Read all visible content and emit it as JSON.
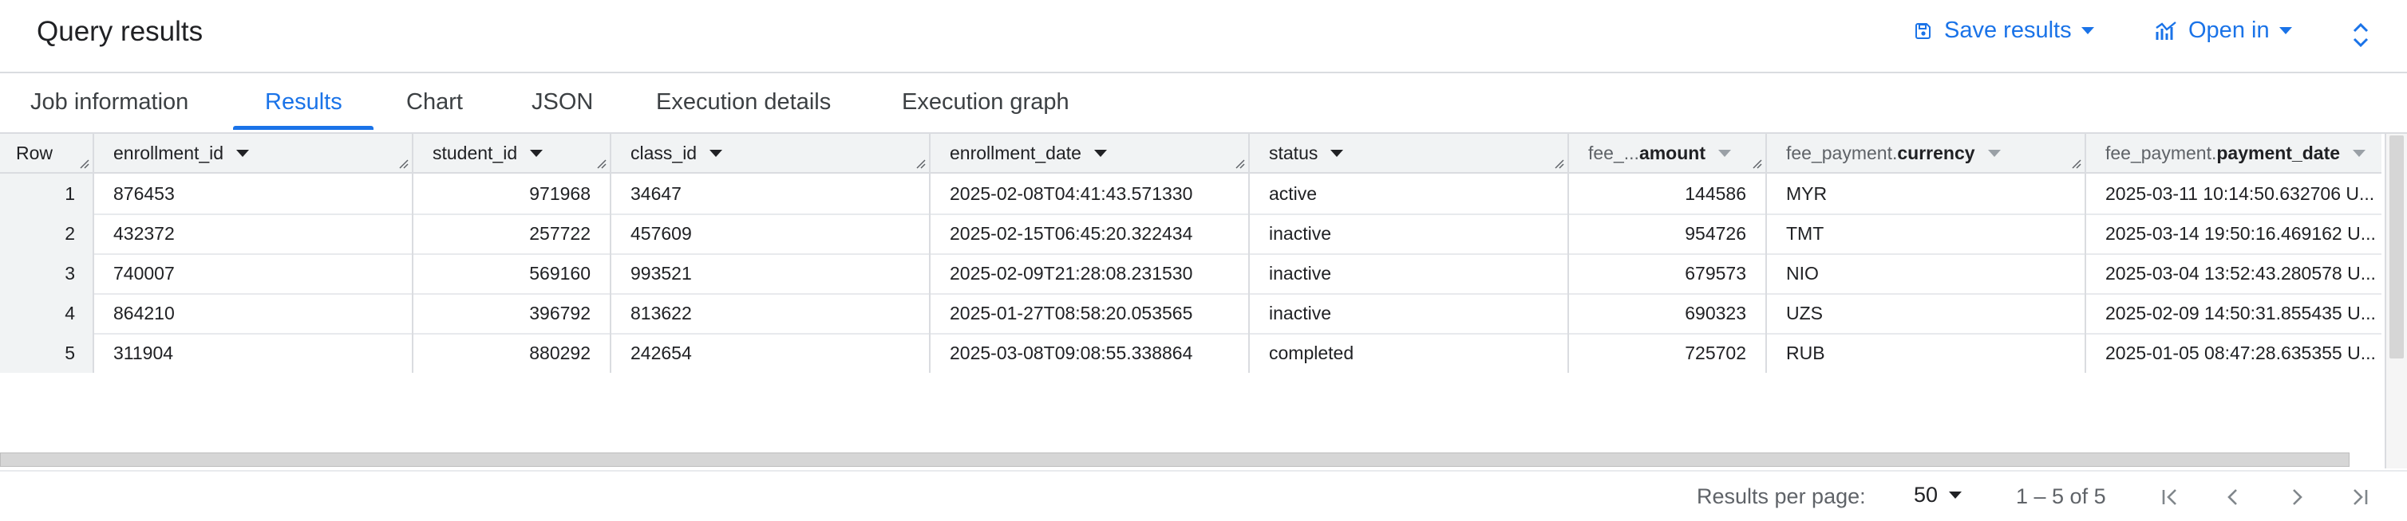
{
  "header": {
    "title": "Query results",
    "save_label": "Save results",
    "open_label": "Open in"
  },
  "tabs": [
    {
      "label": "Job information",
      "active": false
    },
    {
      "label": "Results",
      "active": true
    },
    {
      "label": "Chart",
      "active": false
    },
    {
      "label": "JSON",
      "active": false
    },
    {
      "label": "Execution details",
      "active": false
    },
    {
      "label": "Execution graph",
      "active": false
    }
  ],
  "table": {
    "row_header": "Row",
    "columns": [
      {
        "prefix": "",
        "label": "enrollment_id"
      },
      {
        "prefix": "",
        "label": "student_id"
      },
      {
        "prefix": "",
        "label": "class_id"
      },
      {
        "prefix": "",
        "label": "enrollment_date"
      },
      {
        "prefix": "",
        "label": "status"
      },
      {
        "prefix": "fee_...",
        "label": "amount"
      },
      {
        "prefix": "fee_payment.",
        "label": "currency"
      },
      {
        "prefix": "fee_payment.",
        "label": "payment_date"
      }
    ],
    "rows": [
      {
        "row": "1",
        "cells": [
          "876453",
          "971968",
          "34647",
          "2025-02-08T04:41:43.571330",
          "active",
          "144586",
          "MYR",
          "2025-03-11 10:14:50.632706 U..."
        ]
      },
      {
        "row": "2",
        "cells": [
          "432372",
          "257722",
          "457609",
          "2025-02-15T06:45:20.322434",
          "inactive",
          "954726",
          "TMT",
          "2025-03-14 19:50:16.469162 U..."
        ]
      },
      {
        "row": "3",
        "cells": [
          "740007",
          "569160",
          "993521",
          "2025-02-09T21:28:08.231530",
          "inactive",
          "679573",
          "NIO",
          "2025-03-04 13:52:43.280578 U..."
        ]
      },
      {
        "row": "4",
        "cells": [
          "864210",
          "396792",
          "813622",
          "2025-01-27T08:58:20.053565",
          "inactive",
          "690323",
          "UZS",
          "2025-02-09 14:50:31.855435 U..."
        ]
      },
      {
        "row": "5",
        "cells": [
          "311904",
          "880292",
          "242654",
          "2025-03-08T09:08:55.338864",
          "completed",
          "725702",
          "RUB",
          "2025-01-05 08:47:28.635355 U..."
        ]
      }
    ]
  },
  "footer": {
    "rpp_label": "Results per page:",
    "rpp_value": "50",
    "range": "1 – 5 of 5"
  },
  "colors": {
    "accent": "#1a73e8",
    "header_bg": "#f1f3f4",
    "border": "#dadce0"
  },
  "icons": {
    "save": "save-icon",
    "open": "chart-icon",
    "expand": "unfold-icon",
    "first": "first-page-icon",
    "prev": "chevron-left-icon",
    "next": "chevron-right-icon",
    "last": "last-page-icon"
  }
}
